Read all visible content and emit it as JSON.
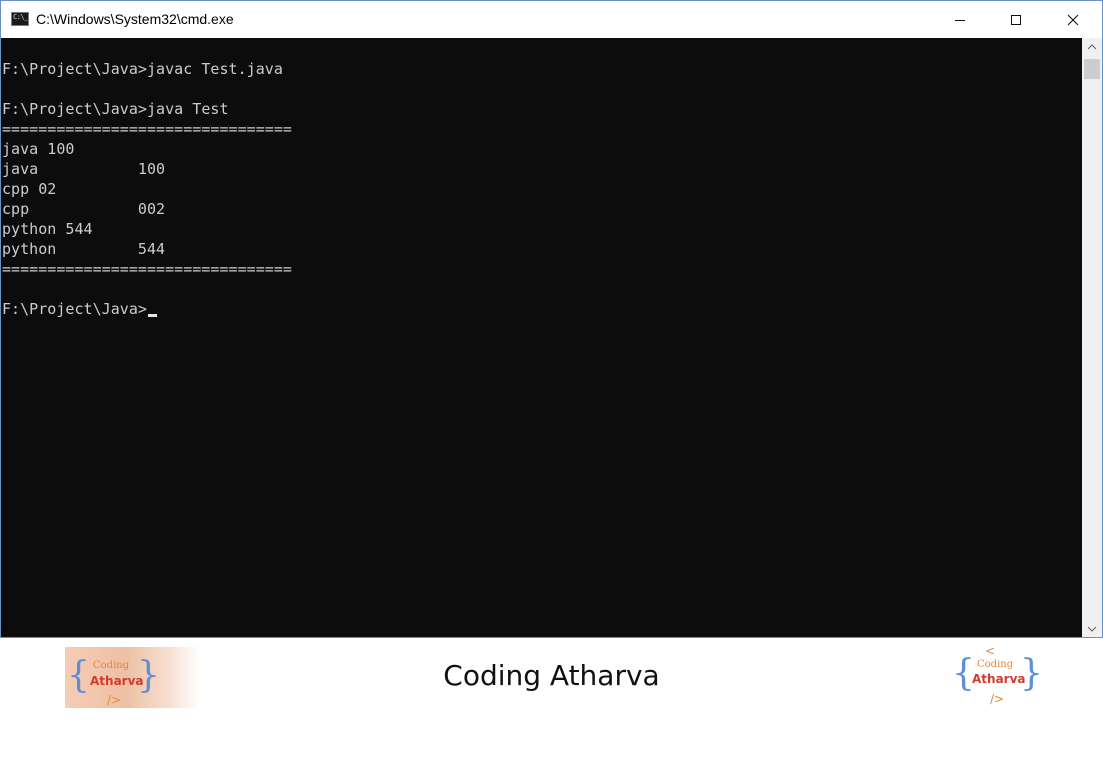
{
  "window": {
    "title": "C:\\Windows\\System32\\cmd.exe",
    "icon": "cmd-icon",
    "controls": [
      "minimize",
      "maximize",
      "close"
    ]
  },
  "terminal": {
    "lines": [
      "F:\\Project\\Java>javac Test.java",
      "F:\\Project\\Java>java Test",
      "================================",
      "java 100",
      "java           100",
      "cpp 02",
      "cpp            002",
      "python 544",
      "python         544",
      "================================",
      "F:\\Project\\Java>"
    ],
    "text_color": "#cccccc",
    "background": "#0c0c0c"
  },
  "footer": {
    "title": "Coding Atharva"
  },
  "logo": {
    "left": {
      "open": "{",
      "top": "Coding",
      "main": "Atharva",
      "close": "}",
      "tag": "/>"
    },
    "right": {
      "open": "{",
      "lt": "<",
      "top": "Coding",
      "main": "Atharva",
      "close": "}",
      "tag": "/>"
    }
  }
}
